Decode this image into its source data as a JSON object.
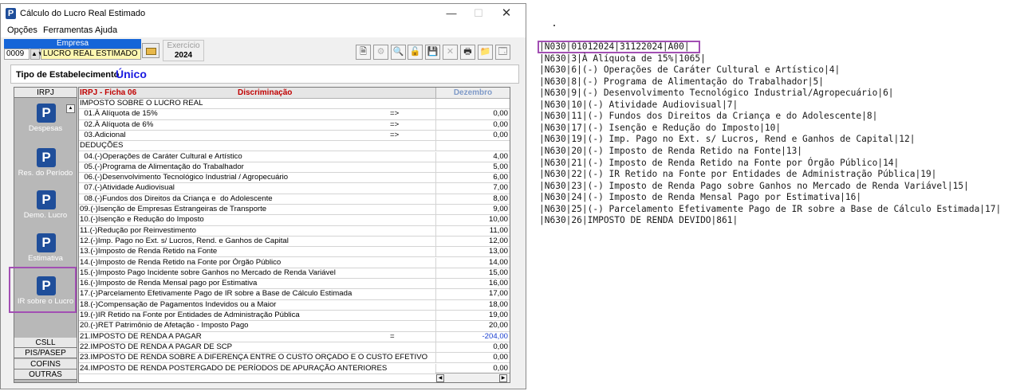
{
  "window": {
    "title": "Cálculo do Lucro Real Estimado",
    "controls": {
      "minimize": "—",
      "maximize": "☐",
      "close": "✕"
    }
  },
  "menu": [
    "Opções",
    "Ferramentas",
    "Ajuda"
  ],
  "empresa": {
    "label": "Empresa",
    "code": "0009",
    "name": "LUCRO REAL ESTIMADO"
  },
  "exercicio": {
    "label": "Exercício",
    "year": "2024"
  },
  "toolbar": [
    {
      "icon": "document-icon",
      "glyph": "🗎",
      "disabled": false
    },
    {
      "icon": "gear-icon",
      "glyph": "⚙",
      "disabled": true
    },
    {
      "icon": "find-icon",
      "glyph": "🔍",
      "disabled": true
    },
    {
      "icon": "unlock-icon",
      "glyph": "🔓",
      "disabled": false
    },
    {
      "icon": "save-icon",
      "glyph": "💾",
      "disabled": false
    },
    {
      "icon": "delete-icon",
      "glyph": "✕",
      "disabled": true
    },
    {
      "icon": "print-icon",
      "glyph": "🖶",
      "disabled": false
    },
    {
      "icon": "export-icon",
      "glyph": "📁",
      "disabled": false
    },
    {
      "icon": "report-icon",
      "glyph": "🗔",
      "disabled": false
    }
  ],
  "estabelecimento": {
    "label": "Tipo de Estabelecimento",
    "value": "Único"
  },
  "nav": {
    "top_tab": "IRPJ",
    "items": [
      {
        "label": "Despesas"
      },
      {
        "label": "Res. do Período"
      },
      {
        "label": "Demo. Lucro"
      },
      {
        "label": "Estimativa"
      },
      {
        "label": "IR sobre o Lucro"
      }
    ],
    "bottom_tabs": [
      "CSLL",
      "PIS/PASEP",
      "COFINS",
      "OUTRAS"
    ]
  },
  "grid": {
    "header": {
      "ficha": "IRPJ - Ficha 06",
      "discriminacao": "Discriminação",
      "mes": "Dezembro"
    },
    "rows": [
      {
        "desc": "IMPOSTO SOBRE O LUCRO REAL",
        "op": "",
        "value": ""
      },
      {
        "desc": "  01.À Alíquota de 15%",
        "op": "=>",
        "value": "0,00"
      },
      {
        "desc": "  02.À Alíquota de 6%",
        "op": "=>",
        "value": "0,00"
      },
      {
        "desc": "  03.Adicional",
        "op": "=>",
        "value": "0,00"
      },
      {
        "desc": "DEDUÇÕES",
        "op": "",
        "value": ""
      },
      {
        "desc": "  04.(-)Operações de Caráter Cultural e Artístico",
        "op": "",
        "value": "4,00"
      },
      {
        "desc": "  05.(-)Programa de Alimentação do Trabalhador",
        "op": "",
        "value": "5,00"
      },
      {
        "desc": "  06.(-)Desenvolvimento Tecnológico Industrial / Agropecuário",
        "op": "",
        "value": "6,00"
      },
      {
        "desc": "  07.(-)Atividade Audiovisual",
        "op": "",
        "value": "7,00"
      },
      {
        "desc": "  08.(-)Fundos dos Direitos da Criança e  do Adolescente",
        "op": "",
        "value": "8,00"
      },
      {
        "desc": "09.(-)Isenção de Empresas Estrangeiras de Transporte",
        "op": "",
        "value": "9,00"
      },
      {
        "desc": "10.(-)Isenção e Redução do Imposto",
        "op": "",
        "value": "10,00"
      },
      {
        "desc": "11.(-)Redução por Reinvestimento",
        "op": "",
        "value": "11,00"
      },
      {
        "desc": "12.(-)Imp. Pago no Ext. s/ Lucros, Rend. e Ganhos de Capital",
        "op": "",
        "value": "12,00"
      },
      {
        "desc": "13.(-)Imposto de Renda Retido na Fonte",
        "op": "",
        "value": "13,00"
      },
      {
        "desc": "14.(-)Imposto de Renda Retido na Fonte por Órgão Público",
        "op": "",
        "value": "14,00"
      },
      {
        "desc": "15.(-)Imposto Pago Incidente sobre Ganhos no Mercado de Renda Variável",
        "op": "",
        "value": "15,00"
      },
      {
        "desc": "16.(-)Imposto de Renda Mensal pago por Estimativa",
        "op": "",
        "value": "16,00"
      },
      {
        "desc": "17.(-)Parcelamento Efetivamente Pago de IR sobre a Base de Cálculo Estimada",
        "op": "",
        "value": "17,00"
      },
      {
        "desc": "18.(-)Compensação de Pagamentos Indevidos ou a Maior",
        "op": "",
        "value": "18,00"
      },
      {
        "desc": "19.(-)IR Retido na Fonte por Entidades de Administração Pública",
        "op": "",
        "value": "19,00"
      },
      {
        "desc": "20.(-)RET Patrimônio de Afetação - Imposto Pago",
        "op": "",
        "value": "20,00"
      },
      {
        "desc": "21.IMPOSTO DE RENDA A PAGAR",
        "op": "=",
        "value": "-204,00"
      },
      {
        "desc": "22.IMPOSTO DE RENDA A PAGAR DE SCP",
        "op": "",
        "value": "0,00"
      },
      {
        "desc": "23.IMPOSTO DE RENDA SOBRE A DIFERENÇA ENTRE O CUSTO ORÇADO E O CUSTO EFETIVO",
        "op": "",
        "value": "0,00"
      },
      {
        "desc": "24.IMPOSTO DE RENDA POSTERGADO DE PERÍODOS DE APURAÇÃO ANTERIORES",
        "op": "",
        "value": "0,00"
      }
    ]
  },
  "text_file": {
    "lines": [
      "|N030|01012024|31122024|A00|",
      "|N630|3|À Alíquota de 15%|1065|",
      "|N630|6|(-) Operações de Caráter Cultural e Artístico|4|",
      "|N630|8|(-) Programa de Alimentação do Trabalhador|5|",
      "|N630|9|(-) Desenvolvimento Tecnológico Industrial/Agropecuário|6|",
      "|N630|10|(-) Atividade Audiovisual|7|",
      "|N630|11|(-) Fundos dos Direitos da Criança e do Adolescente|8|",
      "|N630|17|(-) Isenção e Redução do Imposto|10|",
      "|N630|19|(-) Imp. Pago no Ext. s/ Lucros, Rend e Ganhos de Capital|12|",
      "|N630|20|(-) Imposto de Renda Retido na Fonte|13|",
      "|N630|21|(-) Imposto de Renda Retido na Fonte por Órgão Público|14|",
      "|N630|22|(-) IR Retido na Fonte por Entidades de Administração Pública|19|",
      "|N630|23|(-) Imposto de Renda Pago sobre Ganhos no Mercado de Renda Variável|15|",
      "|N630|24|(-) Imposto de Renda Mensal Pago por Estimativa|16|",
      "|N630|25|(-) Parcelamento Efetivamente Pago de IR sobre a Base de Cálculo Estimada|17|",
      "|N630|26|IMPOSTO DE RENDA DEVIDO|861|"
    ]
  },
  "colors": {
    "accent_blue": "#1565d8",
    "highlight_purple": "#a24fb3",
    "header_red": "#c00000",
    "negative_blue": "#1a3fd0"
  }
}
